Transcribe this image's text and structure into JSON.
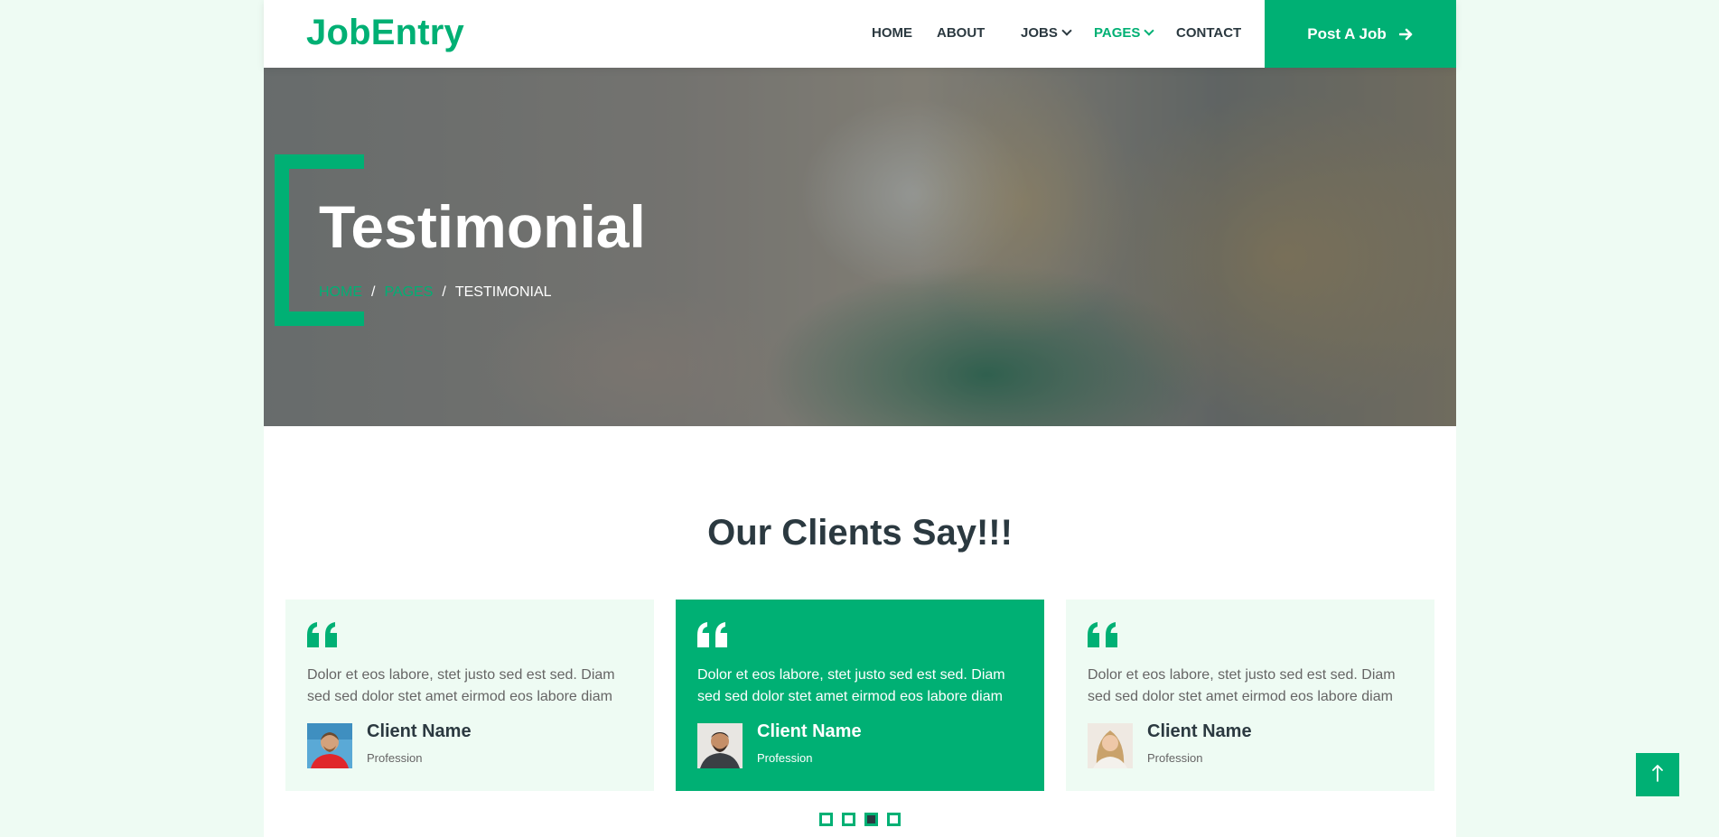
{
  "brand": {
    "name": "JobEntry",
    "color": "#00b074"
  },
  "nav": {
    "items": [
      {
        "label": "Home",
        "dropdown": false,
        "active": false
      },
      {
        "label": "About",
        "dropdown": false,
        "active": false
      },
      {
        "label": "Jobs",
        "dropdown": true,
        "active": false
      },
      {
        "label": "Pages",
        "dropdown": true,
        "active": true
      },
      {
        "label": "Contact",
        "dropdown": false,
        "active": false
      }
    ],
    "cta": {
      "label": "Post A Job",
      "icon": "arrow-right-icon"
    }
  },
  "hero": {
    "title": "Testimonial",
    "breadcrumb": [
      "HOME",
      "PAGES",
      "TESTIMONIAL"
    ]
  },
  "section": {
    "title": "Our Clients Say!!!"
  },
  "testimonials": [
    {
      "text": "Dolor et eos labore, stet justo sed est sed. Diam sed sed dolor stet amet eirmod eos labore diam",
      "name": "Client Name",
      "profession": "Profession",
      "active": false
    },
    {
      "text": "Dolor et eos labore, stet justo sed est sed. Diam sed sed dolor stet amet eirmod eos labore diam",
      "name": "Client Name",
      "profession": "Profession",
      "active": true
    },
    {
      "text": "Dolor et eos labore, stet justo sed est sed. Diam sed sed dolor stet amet eirmod eos labore diam",
      "name": "Client Name",
      "profession": "Profession",
      "active": false
    }
  ],
  "carousel": {
    "dot_count": 4,
    "active_index": 2
  },
  "back_to_top": {
    "icon": "arrow-up-icon"
  },
  "colors": {
    "primary": "#00b074",
    "dark": "#2b3940",
    "light": "#eefbf3",
    "muted": "#666565"
  }
}
